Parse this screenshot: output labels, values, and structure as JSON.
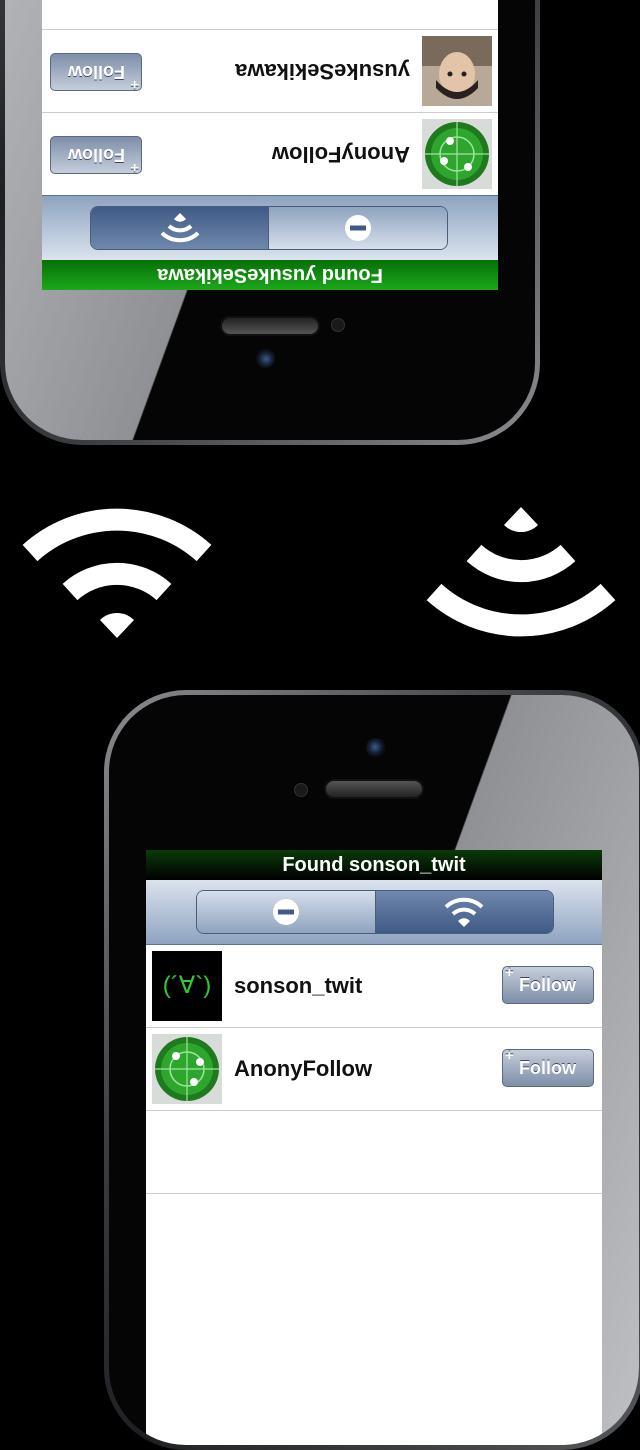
{
  "bottom_phone": {
    "status_text": "Found sonson_twit",
    "users": [
      {
        "name": "sonson_twit",
        "follow_label": "Follow",
        "follow_plus": "+",
        "avatar_text": "(´∀`)"
      },
      {
        "name": "AnonyFollow",
        "follow_label": "Follow",
        "follow_plus": "+"
      }
    ]
  },
  "top_phone": {
    "status_text": "Found yusukeSekikawa",
    "users": [
      {
        "name": "yusukeSekikawa",
        "follow_label": "Follow",
        "follow_plus": "+"
      },
      {
        "name": "AnonyFollow",
        "follow_label": "Follow",
        "follow_plus": "+"
      }
    ]
  },
  "icons": {
    "left_signal": "wifi-icon",
    "right_signal": "wifi-icon"
  },
  "colors": {
    "status_bottom": "#000000",
    "status_top": "#0a9a0a",
    "toolbar": "#a8b9d2",
    "follow_button": "#8a9ab2"
  }
}
